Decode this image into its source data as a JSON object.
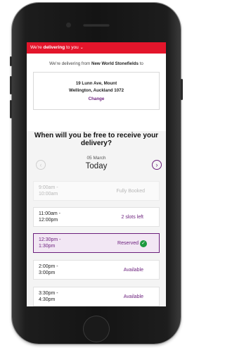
{
  "topbar": {
    "prefix": "We're ",
    "emphasis": "delivering",
    "suffix": " to you",
    "chevron": "⌄"
  },
  "intro": {
    "prefix": "We're delivering from ",
    "store": "New World Stonefields",
    "suffix": " to"
  },
  "address": {
    "line1": "19 Lunn Ave, Mount",
    "line2": "Wellington, Auckland 1072",
    "change_label": "Change"
  },
  "question": {
    "line1": "When will you be free to receive your",
    "line2": "delivery?"
  },
  "date": {
    "small": "05 March",
    "big": "Today",
    "prev_icon": "‹",
    "next_icon": "›"
  },
  "slots": [
    {
      "time1": "9:00am -",
      "time2": "10:00am",
      "status": "Fully Booked"
    },
    {
      "time1": "11:00am -",
      "time2": "12:00pm",
      "status": "2 slots left"
    },
    {
      "time1": "12:30pm -",
      "time2": "1:30pm",
      "status": "Reserved"
    },
    {
      "time1": "2:00pm -",
      "time2": "3:00pm",
      "status": "Available"
    },
    {
      "time1": "3:30pm -",
      "time2": "4:30pm",
      "status": "Available"
    }
  ],
  "colors": {
    "brand_red": "#e3152b",
    "accent_purple": "#6b1f7c",
    "reserved_green": "#1c9a3e"
  }
}
